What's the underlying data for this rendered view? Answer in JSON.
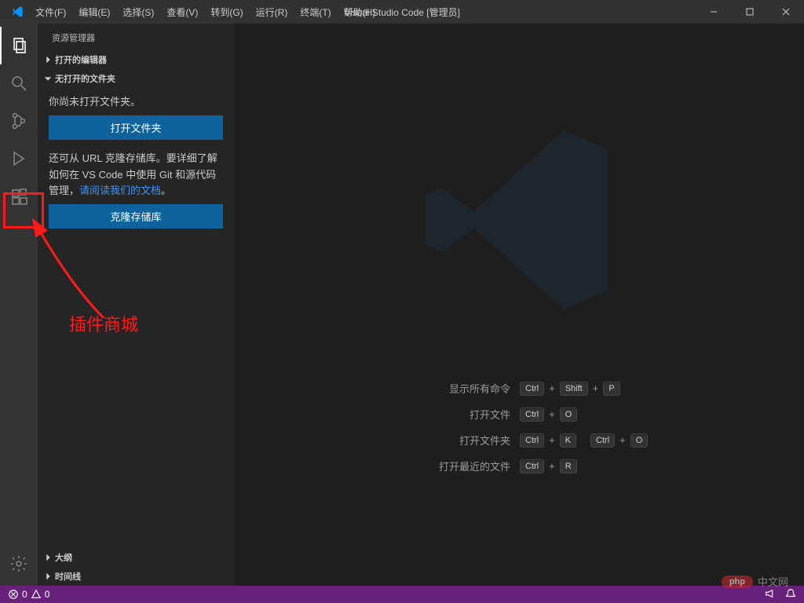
{
  "window": {
    "title": "Visual Studio Code [管理员]"
  },
  "menu": {
    "file": "文件(F)",
    "edit": "编辑(E)",
    "select": "选择(S)",
    "view": "查看(V)",
    "go": "转到(G)",
    "run": "运行(R)",
    "terminal": "终端(T)",
    "help": "帮助(H)"
  },
  "sidebar": {
    "title": "资源管理器",
    "sections": {
      "openEditors": "打开的编辑器",
      "noFolder": "无打开的文件夹",
      "outline": "大纲",
      "timeline": "时间线"
    },
    "noFolderBody": {
      "line1": "你尚未打开文件夹。",
      "openBtn": "打开文件夹",
      "line2a": "还可从 URL 克隆存储库。要详细了解如何在 VS Code 中使用 Git 和源代码管理，",
      "docLink": "请阅读我们的文档",
      "period": "。",
      "cloneBtn": "克隆存储库"
    }
  },
  "shortcuts": {
    "showAll": {
      "label": "显示所有命令",
      "keys": [
        "Ctrl",
        "Shift",
        "P"
      ]
    },
    "openFile": {
      "label": "打开文件",
      "keys": [
        "Ctrl",
        "O"
      ]
    },
    "openFolder": {
      "label": "打开文件夹",
      "keys": [
        "Ctrl",
        "K",
        "Ctrl",
        "O"
      ]
    },
    "openRecent": {
      "label": "打开最近的文件",
      "keys": [
        "Ctrl",
        "R"
      ]
    }
  },
  "statusbar": {
    "errors": "0",
    "warnings": "0"
  },
  "annotation": {
    "label": "插件商城"
  },
  "watermark": {
    "php": "php",
    "phpText": "中文网"
  }
}
